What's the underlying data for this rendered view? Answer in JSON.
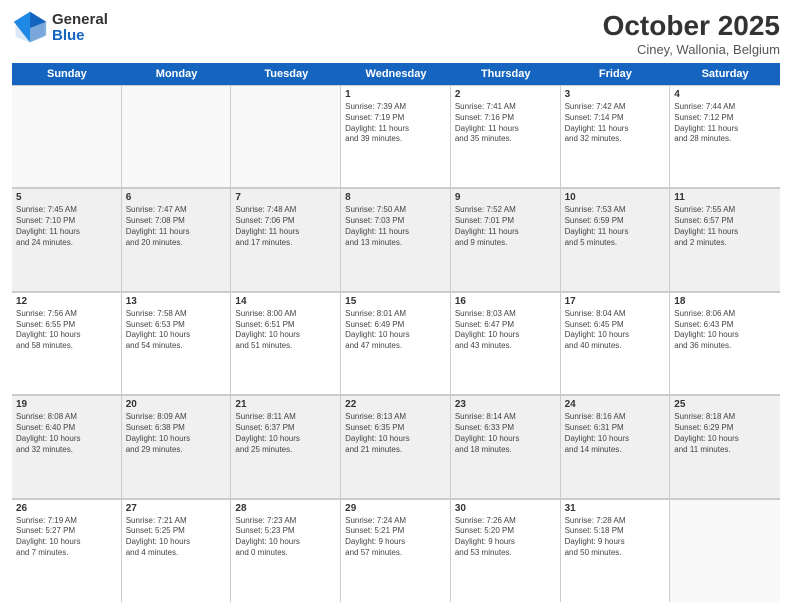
{
  "header": {
    "logo_general": "General",
    "logo_blue": "Blue",
    "month_title": "October 2025",
    "subtitle": "Ciney, Wallonia, Belgium"
  },
  "weekdays": [
    "Sunday",
    "Monday",
    "Tuesday",
    "Wednesday",
    "Thursday",
    "Friday",
    "Saturday"
  ],
  "weeks": [
    [
      {
        "day": "",
        "info": ""
      },
      {
        "day": "",
        "info": ""
      },
      {
        "day": "",
        "info": ""
      },
      {
        "day": "1",
        "info": "Sunrise: 7:39 AM\nSunset: 7:19 PM\nDaylight: 11 hours\nand 39 minutes."
      },
      {
        "day": "2",
        "info": "Sunrise: 7:41 AM\nSunset: 7:16 PM\nDaylight: 11 hours\nand 35 minutes."
      },
      {
        "day": "3",
        "info": "Sunrise: 7:42 AM\nSunset: 7:14 PM\nDaylight: 11 hours\nand 32 minutes."
      },
      {
        "day": "4",
        "info": "Sunrise: 7:44 AM\nSunset: 7:12 PM\nDaylight: 11 hours\nand 28 minutes."
      }
    ],
    [
      {
        "day": "5",
        "info": "Sunrise: 7:45 AM\nSunset: 7:10 PM\nDaylight: 11 hours\nand 24 minutes."
      },
      {
        "day": "6",
        "info": "Sunrise: 7:47 AM\nSunset: 7:08 PM\nDaylight: 11 hours\nand 20 minutes."
      },
      {
        "day": "7",
        "info": "Sunrise: 7:48 AM\nSunset: 7:06 PM\nDaylight: 11 hours\nand 17 minutes."
      },
      {
        "day": "8",
        "info": "Sunrise: 7:50 AM\nSunset: 7:03 PM\nDaylight: 11 hours\nand 13 minutes."
      },
      {
        "day": "9",
        "info": "Sunrise: 7:52 AM\nSunset: 7:01 PM\nDaylight: 11 hours\nand 9 minutes."
      },
      {
        "day": "10",
        "info": "Sunrise: 7:53 AM\nSunset: 6:59 PM\nDaylight: 11 hours\nand 5 minutes."
      },
      {
        "day": "11",
        "info": "Sunrise: 7:55 AM\nSunset: 6:57 PM\nDaylight: 11 hours\nand 2 minutes."
      }
    ],
    [
      {
        "day": "12",
        "info": "Sunrise: 7:56 AM\nSunset: 6:55 PM\nDaylight: 10 hours\nand 58 minutes."
      },
      {
        "day": "13",
        "info": "Sunrise: 7:58 AM\nSunset: 6:53 PM\nDaylight: 10 hours\nand 54 minutes."
      },
      {
        "day": "14",
        "info": "Sunrise: 8:00 AM\nSunset: 6:51 PM\nDaylight: 10 hours\nand 51 minutes."
      },
      {
        "day": "15",
        "info": "Sunrise: 8:01 AM\nSunset: 6:49 PM\nDaylight: 10 hours\nand 47 minutes."
      },
      {
        "day": "16",
        "info": "Sunrise: 8:03 AM\nSunset: 6:47 PM\nDaylight: 10 hours\nand 43 minutes."
      },
      {
        "day": "17",
        "info": "Sunrise: 8:04 AM\nSunset: 6:45 PM\nDaylight: 10 hours\nand 40 minutes."
      },
      {
        "day": "18",
        "info": "Sunrise: 8:06 AM\nSunset: 6:43 PM\nDaylight: 10 hours\nand 36 minutes."
      }
    ],
    [
      {
        "day": "19",
        "info": "Sunrise: 8:08 AM\nSunset: 6:40 PM\nDaylight: 10 hours\nand 32 minutes."
      },
      {
        "day": "20",
        "info": "Sunrise: 8:09 AM\nSunset: 6:38 PM\nDaylight: 10 hours\nand 29 minutes."
      },
      {
        "day": "21",
        "info": "Sunrise: 8:11 AM\nSunset: 6:37 PM\nDaylight: 10 hours\nand 25 minutes."
      },
      {
        "day": "22",
        "info": "Sunrise: 8:13 AM\nSunset: 6:35 PM\nDaylight: 10 hours\nand 21 minutes."
      },
      {
        "day": "23",
        "info": "Sunrise: 8:14 AM\nSunset: 6:33 PM\nDaylight: 10 hours\nand 18 minutes."
      },
      {
        "day": "24",
        "info": "Sunrise: 8:16 AM\nSunset: 6:31 PM\nDaylight: 10 hours\nand 14 minutes."
      },
      {
        "day": "25",
        "info": "Sunrise: 8:18 AM\nSunset: 6:29 PM\nDaylight: 10 hours\nand 11 minutes."
      }
    ],
    [
      {
        "day": "26",
        "info": "Sunrise: 7:19 AM\nSunset: 5:27 PM\nDaylight: 10 hours\nand 7 minutes."
      },
      {
        "day": "27",
        "info": "Sunrise: 7:21 AM\nSunset: 5:25 PM\nDaylight: 10 hours\nand 4 minutes."
      },
      {
        "day": "28",
        "info": "Sunrise: 7:23 AM\nSunset: 5:23 PM\nDaylight: 10 hours\nand 0 minutes."
      },
      {
        "day": "29",
        "info": "Sunrise: 7:24 AM\nSunset: 5:21 PM\nDaylight: 9 hours\nand 57 minutes."
      },
      {
        "day": "30",
        "info": "Sunrise: 7:26 AM\nSunset: 5:20 PM\nDaylight: 9 hours\nand 53 minutes."
      },
      {
        "day": "31",
        "info": "Sunrise: 7:28 AM\nSunset: 5:18 PM\nDaylight: 9 hours\nand 50 minutes."
      },
      {
        "day": "",
        "info": ""
      }
    ]
  ]
}
